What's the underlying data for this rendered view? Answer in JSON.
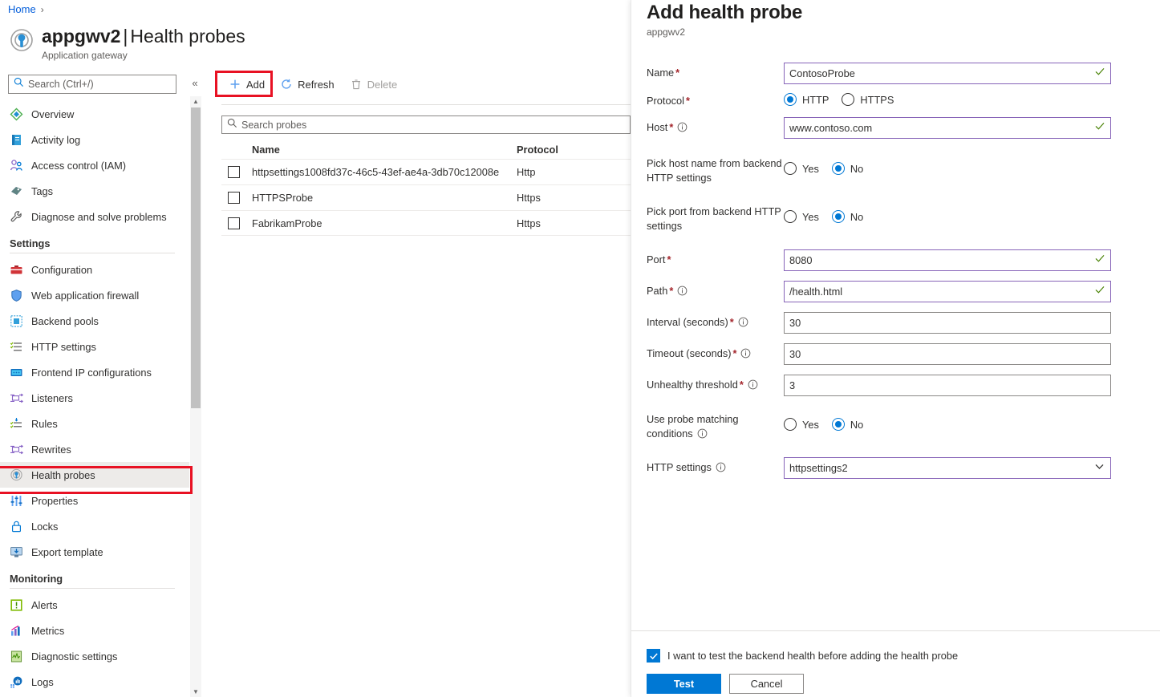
{
  "breadcrumb": {
    "home": "Home",
    "separator": "›"
  },
  "header": {
    "resource_name": "appgwv2",
    "separator": "|",
    "page": "Health probes",
    "subtitle": "Application gateway",
    "icon": "application-gateway-icon"
  },
  "sidebar": {
    "search_placeholder": "Search (Ctrl+/)",
    "search_value": "",
    "collapse_glyph": "«",
    "items": [
      {
        "label": "Overview",
        "icon": "overview-icon",
        "selected": false
      },
      {
        "label": "Activity log",
        "icon": "activity-log-icon",
        "selected": false
      },
      {
        "label": "Access control (IAM)",
        "icon": "access-control-icon",
        "selected": false
      },
      {
        "label": "Tags",
        "icon": "tags-icon",
        "selected": false
      },
      {
        "label": "Diagnose and solve problems",
        "icon": "wrench-icon",
        "selected": false
      }
    ],
    "groups": [
      {
        "title": "Settings",
        "items": [
          {
            "label": "Configuration",
            "icon": "configuration-icon",
            "selected": false
          },
          {
            "label": "Web application firewall",
            "icon": "shield-icon",
            "selected": false
          },
          {
            "label": "Backend pools",
            "icon": "backend-pools-icon",
            "selected": false
          },
          {
            "label": "HTTP settings",
            "icon": "http-settings-icon",
            "selected": false
          },
          {
            "label": "Frontend IP configurations",
            "icon": "frontend-ip-icon",
            "selected": false
          },
          {
            "label": "Listeners",
            "icon": "listeners-icon",
            "selected": false
          },
          {
            "label": "Rules",
            "icon": "rules-icon",
            "selected": false
          },
          {
            "label": "Rewrites",
            "icon": "rewrites-icon",
            "selected": false
          },
          {
            "label": "Health probes",
            "icon": "health-probes-icon",
            "selected": true
          },
          {
            "label": "Properties",
            "icon": "properties-icon",
            "selected": false
          },
          {
            "label": "Locks",
            "icon": "lock-icon",
            "selected": false
          },
          {
            "label": "Export template",
            "icon": "export-template-icon",
            "selected": false
          }
        ]
      },
      {
        "title": "Monitoring",
        "items": [
          {
            "label": "Alerts",
            "icon": "alerts-icon",
            "selected": false
          },
          {
            "label": "Metrics",
            "icon": "metrics-icon",
            "selected": false
          },
          {
            "label": "Diagnostic settings",
            "icon": "diagnostic-settings-icon",
            "selected": false
          },
          {
            "label": "Logs",
            "icon": "logs-icon",
            "selected": false
          }
        ]
      }
    ]
  },
  "commandbar": {
    "add": {
      "label": "Add",
      "icon": "plus-icon",
      "disabled": false,
      "highlighted": true
    },
    "refresh": {
      "label": "Refresh",
      "icon": "refresh-icon",
      "disabled": false
    },
    "delete": {
      "label": "Delete",
      "icon": "trash-icon",
      "disabled": true
    }
  },
  "probes": {
    "search_placeholder": "Search probes",
    "search_value": "",
    "columns": [
      "Name",
      "Protocol"
    ],
    "rows": [
      {
        "name": "httpsettings1008fd37c-46c5-43ef-ae4a-3db70c12008e",
        "protocol": "Http",
        "checked": false
      },
      {
        "name": "HTTPSProbe",
        "protocol": "Https",
        "checked": false
      },
      {
        "name": "FabrikamProbe",
        "protocol": "Https",
        "checked": false
      }
    ]
  },
  "panel": {
    "title": "Add health probe",
    "subtitle": "appgwv2",
    "fields": {
      "name": {
        "label": "Name",
        "required": true,
        "value": "ContosoProbe",
        "valid": true
      },
      "protocol": {
        "label": "Protocol",
        "required": true,
        "options": [
          "HTTP",
          "HTTPS"
        ],
        "selected": "HTTP"
      },
      "host": {
        "label": "Host",
        "required": true,
        "info": true,
        "value": "www.contoso.com",
        "valid": true
      },
      "pick_host": {
        "label": "Pick host name from backend HTTP settings",
        "options": [
          "Yes",
          "No"
        ],
        "selected": "No"
      },
      "pick_port": {
        "label": "Pick port from backend HTTP settings",
        "options": [
          "Yes",
          "No"
        ],
        "selected": "No"
      },
      "port": {
        "label": "Port",
        "required": true,
        "value": "8080",
        "valid": true
      },
      "path": {
        "label": "Path",
        "required": true,
        "info": true,
        "value": "/health.html",
        "valid": true
      },
      "interval": {
        "label": "Interval (seconds)",
        "required": true,
        "info": true,
        "value": "30",
        "valid": false
      },
      "timeout": {
        "label": "Timeout (seconds)",
        "required": true,
        "info": true,
        "value": "30",
        "valid": false
      },
      "unhealthy_threshold": {
        "label": "Unhealthy threshold",
        "required": true,
        "info": true,
        "value": "3",
        "valid": false
      },
      "use_matching": {
        "label": "Use probe matching conditions",
        "info": true,
        "options": [
          "Yes",
          "No"
        ],
        "selected": "No"
      },
      "http_settings": {
        "label": "HTTP settings",
        "info": true,
        "value": "httpsettings2",
        "valid": true,
        "options": [
          "httpsettings2"
        ]
      }
    },
    "footer": {
      "checkbox_label": "I want to test the backend health before adding the health probe",
      "checkbox_checked": true,
      "test_label": "Test",
      "cancel_label": "Cancel"
    }
  },
  "colors": {
    "accent": "#0078d4",
    "highlight": "#e81123",
    "validated_border": "#8764b8",
    "required_star": "#a4262c",
    "valid_check": "#498205"
  }
}
